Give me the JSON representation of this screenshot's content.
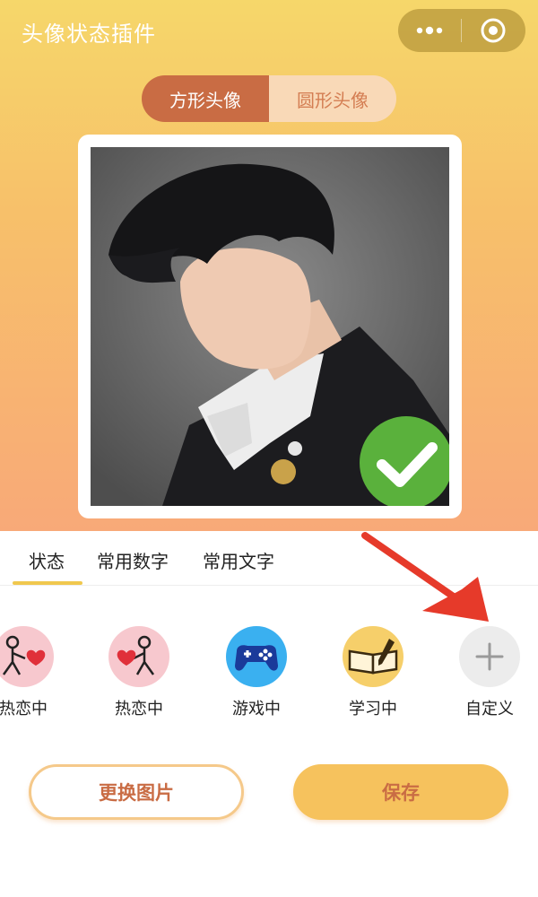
{
  "header": {
    "title": "头像状态插件"
  },
  "shape_toggle": {
    "options": [
      "方形头像",
      "圆形头像"
    ],
    "selected": "方形头像"
  },
  "preview": {
    "status_badge_icon": "check-icon",
    "badge_color": "#5ab13c"
  },
  "tabs": [
    {
      "label": "状态",
      "active": true
    },
    {
      "label": "常用数字",
      "active": false
    },
    {
      "label": "常用文字",
      "active": false
    }
  ],
  "status_items": [
    {
      "label": "热恋中",
      "icon": "heart-hug-icon"
    },
    {
      "label": "热恋中",
      "icon": "heart-hug-icon"
    },
    {
      "label": "游戏中",
      "icon": "gamepad-icon"
    },
    {
      "label": "学习中",
      "icon": "book-pencil-icon"
    },
    {
      "label": "自定义",
      "icon": "plus-icon"
    }
  ],
  "actions": {
    "change_image": "更换图片",
    "save": "保存"
  },
  "colors": {
    "accent": "#c96c44",
    "gold": "#f6c25d",
    "underline": "#f0c84e",
    "arrow": "#e63a2a"
  }
}
